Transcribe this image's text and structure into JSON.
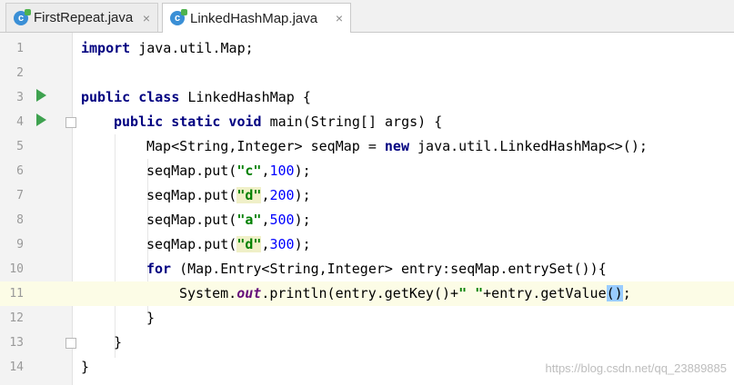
{
  "tabs": [
    {
      "label": "FirstRepeat.java",
      "icon": "java-class-icon",
      "close": "×",
      "active": false
    },
    {
      "label": "LinkedHashMap.java",
      "icon": "java-class-icon",
      "close": "×",
      "active": true
    }
  ],
  "icon_letter": "c",
  "lines": [
    {
      "n": "1"
    },
    {
      "n": "2"
    },
    {
      "n": "3"
    },
    {
      "n": "4"
    },
    {
      "n": "5"
    },
    {
      "n": "6"
    },
    {
      "n": "7"
    },
    {
      "n": "8"
    },
    {
      "n": "9"
    },
    {
      "n": "10"
    },
    {
      "n": "11"
    },
    {
      "n": "12"
    },
    {
      "n": "13"
    },
    {
      "n": "14"
    }
  ],
  "tokens": {
    "l1": [
      "import",
      " java.util.Map;"
    ],
    "l3": [
      "public class",
      " LinkedHashMap {"
    ],
    "l4": [
      "public static void",
      " main(String[] args) {"
    ],
    "l5": [
      "Map<String,Integer> seqMap = ",
      "new",
      " java.util.LinkedHashMap<>();"
    ],
    "l6": [
      "seqMap.put(",
      "\"c\"",
      ",",
      "100",
      ");"
    ],
    "l7": [
      "seqMap.put(",
      "\"d\"",
      ",",
      "200",
      ");"
    ],
    "l8": [
      "seqMap.put(",
      "\"a\"",
      ",",
      "500",
      ");"
    ],
    "l9": [
      "seqMap.put(",
      "\"d\"",
      ",",
      "300",
      ");"
    ],
    "l10": [
      "for",
      " (Map.Entry<String,Integer> entry:seqMap.entrySet()){"
    ],
    "l11": [
      "System.",
      "out",
      ".println(entry.getKey()+",
      "\" \"",
      "+entry.getValue",
      "()",
      ";"
    ],
    "l12": [
      "}"
    ],
    "l13": [
      "}"
    ],
    "l14": [
      "}"
    ]
  },
  "watermark": "https://blog.csdn.net/qq_23889885",
  "colors": {
    "keyword": "#000080",
    "string": "#008000",
    "number": "#0000ff",
    "field": "#660e7a",
    "current_line": "#fcfce6",
    "run_icon": "#3ea24f"
  }
}
